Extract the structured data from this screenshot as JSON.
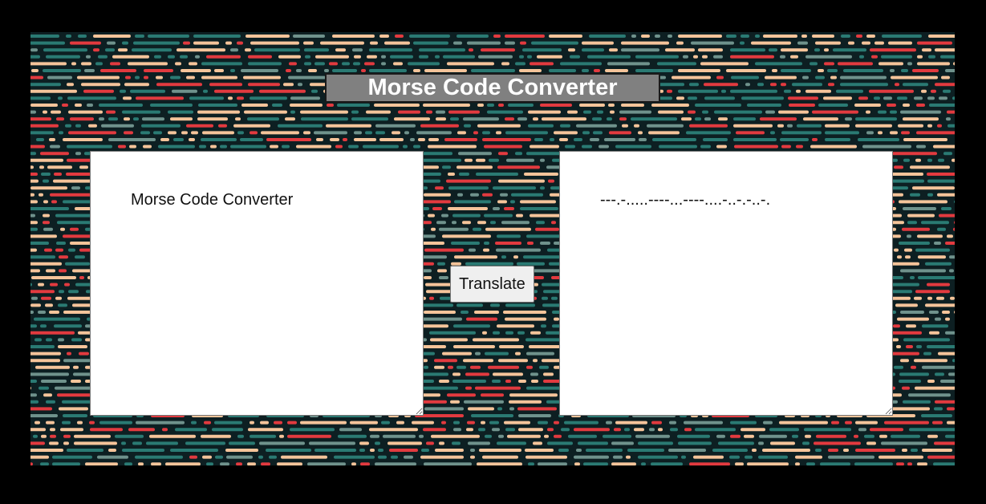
{
  "page": {
    "title": "Morse Code Converter"
  },
  "input": {
    "value": "Morse Code Converter"
  },
  "output": {
    "value": "---.-.....----...----....-..-.-..-."
  },
  "translate_button": {
    "label": "Translate"
  },
  "colors": {
    "page_background": "#000000",
    "pattern_background": "#0d1f22",
    "dash_red": "#e23a3f",
    "dash_peach": "#f5c49a",
    "dash_teal": "#2a7a73",
    "dash_gray_green": "#6f928c",
    "title_background": "#808080",
    "title_text": "#ffffff"
  }
}
